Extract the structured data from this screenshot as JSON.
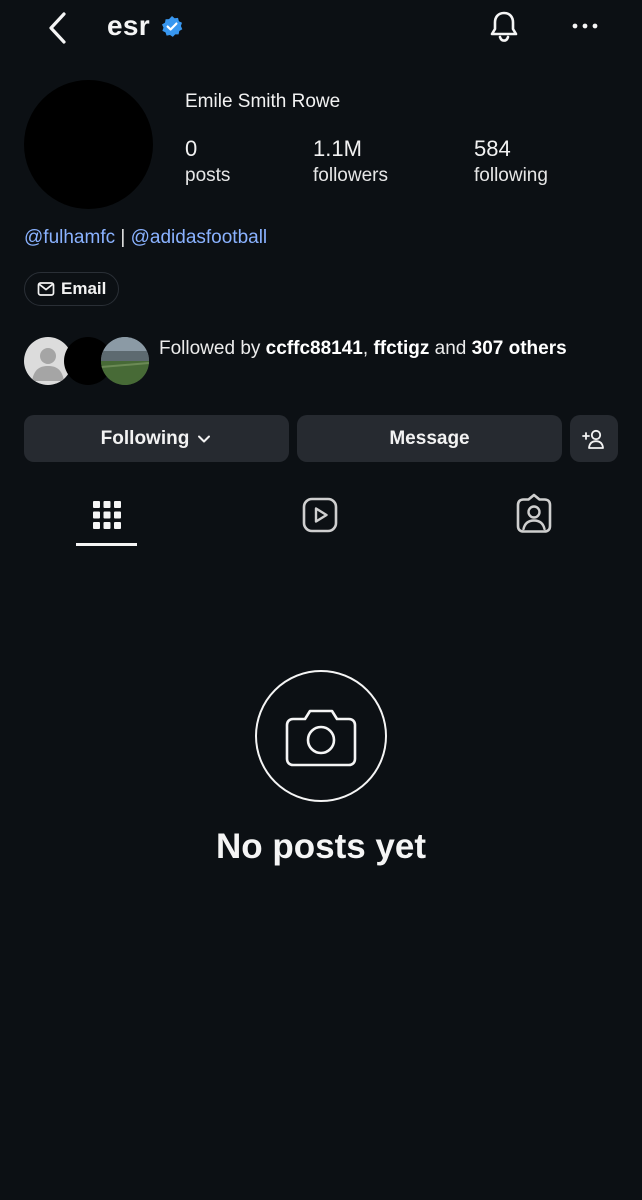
{
  "header": {
    "username": "esr",
    "back_icon": "chevron-left-icon",
    "verified_icon": "verified-badge-icon",
    "notification_icon": "bell-icon",
    "more_icon": "more-horizontal-icon"
  },
  "profile": {
    "full_name": "Emile Smith Rowe",
    "stats": {
      "posts": {
        "value": "0",
        "label": "posts"
      },
      "followers": {
        "value": "1.1M",
        "label": "followers"
      },
      "following": {
        "value": "584",
        "label": "following"
      }
    },
    "bio_links": [
      "@fulhamfc",
      "@adidasfootball"
    ],
    "bio_separator": " | ",
    "email_label": "Email"
  },
  "followed_by": {
    "prefix": "Followed by ",
    "user1": "ccffc88141",
    "separator": ", ",
    "user2": "ffctigz",
    "middle": " and ",
    "count": "307",
    "suffix": " others"
  },
  "actions": {
    "following_label": "Following",
    "message_label": "Message"
  },
  "tabs": {
    "active": "grid",
    "items": [
      "grid-icon",
      "reels-icon",
      "tagged-icon"
    ]
  },
  "empty_state": {
    "text": "No posts yet",
    "icon": "camera-icon"
  },
  "colors": {
    "background": "#0c1014",
    "button": "#262a30",
    "link": "#8ab2ff",
    "verified": "#3897f0"
  }
}
